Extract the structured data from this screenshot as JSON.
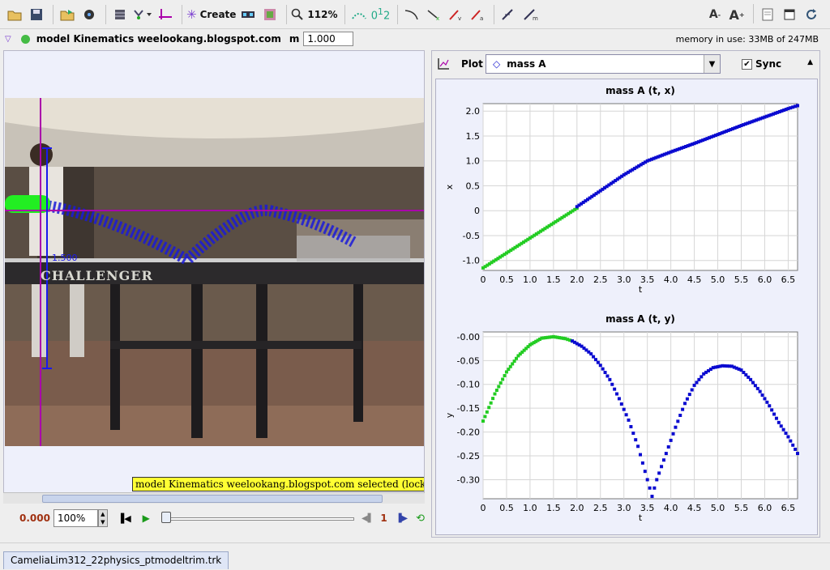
{
  "toolbar": {
    "create_label": "Create",
    "zoom_label": "112%",
    "icons": [
      "open-folder-icon",
      "save-icon",
      "import-icon",
      "video-icon",
      "clip-settings-icon",
      "track-control-icon",
      "axes-icon",
      "create-star-icon",
      "calibration-icon",
      "image-filter-icon",
      "magnifier-icon",
      "coordinates-icon",
      "measure-icon",
      "angle-icon",
      "velocity-icon",
      "acceleration-icon",
      "x-velocity-icon",
      "momentum-icon",
      "font-smaller-icon",
      "font-larger-icon",
      "notes-icon",
      "window-icon",
      "refresh-icon"
    ]
  },
  "modelbar": {
    "model_name": "model Kinematics weelookang.blogspot.com",
    "mass_label": "m",
    "mass_value": "1.000",
    "memory": "memory in use: 33MB of 247MB"
  },
  "video": {
    "axis_label": "1.500",
    "table_text": "CHALLENGER",
    "status": "model Kinematics weelookang.blogspot.com selected (locked)"
  },
  "player": {
    "time": "0.000",
    "zoom": "100%",
    "step": "1"
  },
  "plot_panel": {
    "plot_label": "Plot",
    "selected_track": "mass A",
    "sync_label": "Sync"
  },
  "tab": {
    "label": "CameliaLim312_22physics_ptmodeltrim.trk"
  },
  "colors": {
    "model": "#22cc22",
    "track": "#0a0ad0",
    "axis": "#aa00aa"
  },
  "chart_data": [
    {
      "type": "scatter",
      "title": "mass A (t, x)",
      "xlabel": "t",
      "ylabel": "x",
      "xlim": [
        0,
        6.7
      ],
      "ylim": [
        -1.2,
        2.15
      ],
      "xticks": [
        "0",
        "0.5",
        "1.0",
        "1.5",
        "2.0",
        "2.5",
        "3.0",
        "3.5",
        "4.0",
        "4.5",
        "5.0",
        "5.5",
        "6.0",
        "6.5"
      ],
      "yticks": [
        "-1.0",
        "-0.5",
        "0",
        "0.5",
        "1.0",
        "1.5",
        "2.0"
      ],
      "grid": true,
      "series": [
        {
          "color": "#22cc22",
          "x": [
            0,
            0.5,
            1.0,
            1.5,
            2.0
          ],
          "y": [
            -1.15,
            -0.85,
            -0.55,
            -0.25,
            0.05
          ]
        },
        {
          "color": "#0a0ad0",
          "x": [
            2.0,
            2.5,
            3.0,
            3.5,
            4.0,
            4.5,
            5.0,
            5.5,
            6.0,
            6.5,
            6.7
          ],
          "y": [
            0.08,
            0.4,
            0.72,
            1.0,
            1.18,
            1.35,
            1.53,
            1.71,
            1.88,
            2.05,
            2.11
          ]
        }
      ]
    },
    {
      "type": "scatter",
      "title": "mass A (t, y)",
      "xlabel": "t",
      "ylabel": "y",
      "xlim": [
        0,
        6.7
      ],
      "ylim": [
        -0.34,
        0.01
      ],
      "xticks": [
        "0",
        "0.5",
        "1.0",
        "1.5",
        "2.0",
        "2.5",
        "3.0",
        "3.5",
        "4.0",
        "4.5",
        "5.0",
        "5.5",
        "6.0",
        "6.5"
      ],
      "yticks": [
        "-0.00",
        "-0.05",
        "-0.10",
        "-0.15",
        "-0.20",
        "-0.25",
        "-0.30"
      ],
      "grid": true,
      "series": [
        {
          "color": "#22cc22",
          "x": [
            0,
            0.25,
            0.5,
            0.75,
            1.0,
            1.25,
            1.5,
            1.75,
            1.9
          ],
          "y": [
            -0.177,
            -0.12,
            -0.074,
            -0.04,
            -0.017,
            -0.003,
            0.0,
            -0.004,
            -0.009
          ]
        },
        {
          "color": "#0a0ad0",
          "x": [
            1.9,
            2.1,
            2.3,
            2.5,
            2.7,
            2.9,
            3.1,
            3.3,
            3.5,
            3.6,
            3.7,
            3.9,
            4.1,
            4.3,
            4.5,
            4.7,
            4.9,
            5.1,
            5.3,
            5.5,
            5.7,
            5.9,
            6.1,
            6.3,
            6.5,
            6.7
          ],
          "y": [
            -0.009,
            -0.02,
            -0.036,
            -0.06,
            -0.09,
            -0.13,
            -0.175,
            -0.23,
            -0.3,
            -0.335,
            -0.3,
            -0.245,
            -0.19,
            -0.14,
            -0.102,
            -0.078,
            -0.065,
            -0.061,
            -0.062,
            -0.07,
            -0.09,
            -0.115,
            -0.145,
            -0.18,
            -0.21,
            -0.245
          ]
        }
      ]
    }
  ]
}
